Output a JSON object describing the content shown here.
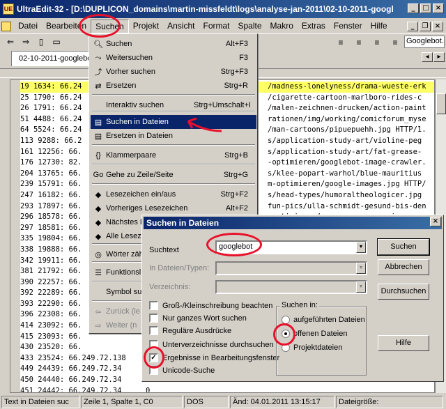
{
  "window": {
    "title": "UltraEdit-32 - [D:\\DUPLICON_domains\\martin-missfeldt\\logs\\analyse-jan-2011\\02-10-2011-googlel"
  },
  "menubar": {
    "items": [
      "Datei",
      "Bearbeiten",
      "Suchen",
      "Projekt",
      "Ansicht",
      "Format",
      "Spalte",
      "Makro",
      "Extras",
      "Fenster",
      "Hilfe"
    ]
  },
  "toolbar": {
    "combo_value": "Googlebot."
  },
  "tab": {
    "label": "02-10-2011-googlebo"
  },
  "editor": {
    "lines": [
      "19 1634: 66.24",
      "25 1790: 66.24",
      "26 1791: 66.24",
      "51 4488: 66.24",
      "64 5524: 66.24",
      "113 9288: 66.2",
      "161 12256: 66.",
      "176 12730: 82.",
      "204 13765: 66.",
      "239 15791: 66.",
      "247 16182: 66.",
      "293 17897: 66.",
      "296 18578: 66.",
      "297 18581: 66.",
      "335 19804: 66.",
      "338 19888: 66.",
      "342 19911: 66.",
      "381 21792: 66.",
      "390 22257: 66.",
      "392 22289: 66.",
      "393 22290: 66.",
      "396 22308: 66.",
      "414 23092: 66.",
      "415 23093: 66.",
      "430 23520: 66.",
      "433 23524: 66.249.72.138",
      "449 24439: 66.249.72.34",
      "450 24440: 66.249.72.34",
      "451 24442: 66.249.72.34"
    ],
    "right_fragments": [
      "/madness-lonelyness/drama-wueste-erk",
      "/cigarette-cartoon-marlboro-rides-c",
      "/malen-zeichnen-drucken/action-paint",
      "rationen/img/working/comicforum_myse",
      "/man-cartoons/pipuepuehh.jpg HTTP/1.",
      "s/application-study-art/violine-peg",
      "s/application-study-art/fat-grease-",
      "-optimieren/googlebot-image-crawler.",
      "s/klee-popart-warhol/blue-mauritius",
      "m-optimieren/google-images.jpg HTTP/",
      "s/head-types/humoraltheologicer.jpg",
      "fun-pics/ulla-schmidt-gesund-bis-den",
      "-optimieren/german-seos-as-simpsons",
      "s/tips-lowred-videos/jewel-browns"
    ],
    "right_fragments_tail": [
      "0",
      "0",
      "0"
    ]
  },
  "statusbar": {
    "hint": "Text in Dateien suc",
    "position": "Zeile 1, Spalte 1, C0",
    "format": "DOS",
    "modified": "Änd: 04.01.2011 13:15:17",
    "filesize": "Dateigröße:"
  },
  "search_menu": {
    "items": [
      {
        "label": "Suchen",
        "shortcut": "Alt+F3",
        "icon": "magnifier"
      },
      {
        "label": "Weitersuchen",
        "shortcut": "F3",
        "icon": "find-next"
      },
      {
        "label": "Vorher suchen",
        "shortcut": "Strg+F3",
        "icon": "find-prev"
      },
      {
        "label": "Ersetzen",
        "shortcut": "Strg+R",
        "icon": "replace"
      },
      {
        "label": "Interaktiv suchen",
        "shortcut": "Strg+Umschalt+I",
        "icon": ""
      },
      {
        "label": "Suchen in Dateien",
        "shortcut": "",
        "icon": "folder-find"
      },
      {
        "label": "Ersetzen in Dateien",
        "shortcut": "",
        "icon": "folder-replace"
      },
      {
        "label": "Klammerpaare",
        "shortcut": "Strg+B",
        "icon": "braces"
      },
      {
        "label": "Gehe zu Zeile/Seite",
        "shortcut": "Strg+G",
        "icon": "goto"
      },
      {
        "label": "Lesezeichen ein/aus",
        "shortcut": "Strg+F2",
        "icon": "bookmark"
      },
      {
        "label": "Vorheriges Lesezeichen",
        "shortcut": "Alt+F2",
        "icon": "bookmark-prev"
      },
      {
        "label": "Nächstes L",
        "shortcut": "",
        "icon": "bookmark-next"
      },
      {
        "label": "Alle Lesez",
        "shortcut": "",
        "icon": "bookmark-clear"
      },
      {
        "label": "Wörter zäh",
        "shortcut": "",
        "icon": "word-count"
      },
      {
        "label": "Funktionsl",
        "shortcut": "",
        "icon": "function-list"
      },
      {
        "label": "Symbol su",
        "shortcut": "",
        "icon": ""
      },
      {
        "label": "Zurück (le",
        "shortcut": "",
        "icon": "back"
      },
      {
        "label": "Weiter (n",
        "shortcut": "",
        "icon": "forward"
      }
    ]
  },
  "dialog": {
    "title": "Suchen in Dateien",
    "suchtext_label": "Suchtext",
    "suchtext_value": "googlebot",
    "dateien_label": "In Dateien/Typen:",
    "verzeichnis_label": "Verzeichnis:",
    "btn_suchen": "Suchen",
    "btn_abbrechen": "Abbrechen",
    "btn_durchsuchen": "Durchsuchen",
    "btn_hilfe": "Hilfe",
    "checkboxes": [
      {
        "label": "Groß-/Kleinschreibung beachten",
        "checked": false
      },
      {
        "label": "Nur ganzes Wort suchen",
        "checked": false
      },
      {
        "label": "Reguläre Ausdrücke",
        "checked": false
      },
      {
        "label": "Unterverzeichnisse durchsuchen",
        "checked": false
      },
      {
        "label": "Ergebnisse in Bearbeitungsfenster",
        "checked": true
      },
      {
        "label": "Unicode-Suche",
        "checked": false
      }
    ],
    "group_title": "Suchen in:",
    "radios": [
      {
        "label": "aufgeführten Dateien",
        "selected": false
      },
      {
        "label": "offenen Dateien",
        "selected": true
      },
      {
        "label": "Projektdateien",
        "selected": false
      }
    ]
  },
  "colors": {
    "titlebar": "#0a246a",
    "highlight_line": "#ffff66",
    "annotation": "#e8102a"
  }
}
